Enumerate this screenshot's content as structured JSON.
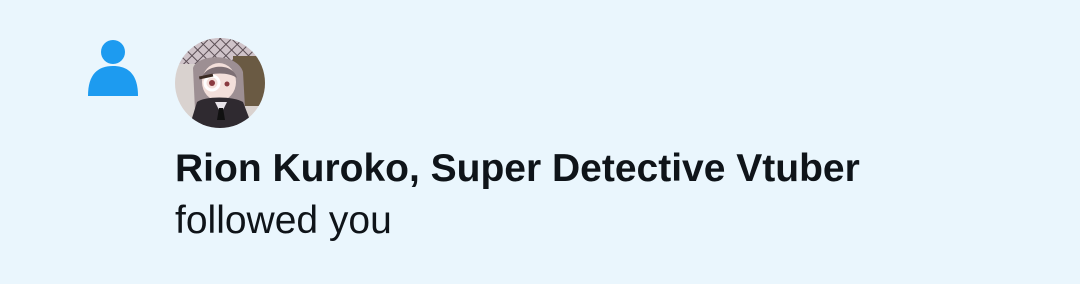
{
  "notification": {
    "type_icon": "person-icon",
    "avatar_icon": "user-avatar",
    "actor_name": "Rion Kuroko, Super Detective Vtuber",
    "action": "followed you"
  },
  "colors": {
    "background": "#eaf6fd",
    "accent": "#1d9bf0",
    "text": "#0f1419"
  }
}
